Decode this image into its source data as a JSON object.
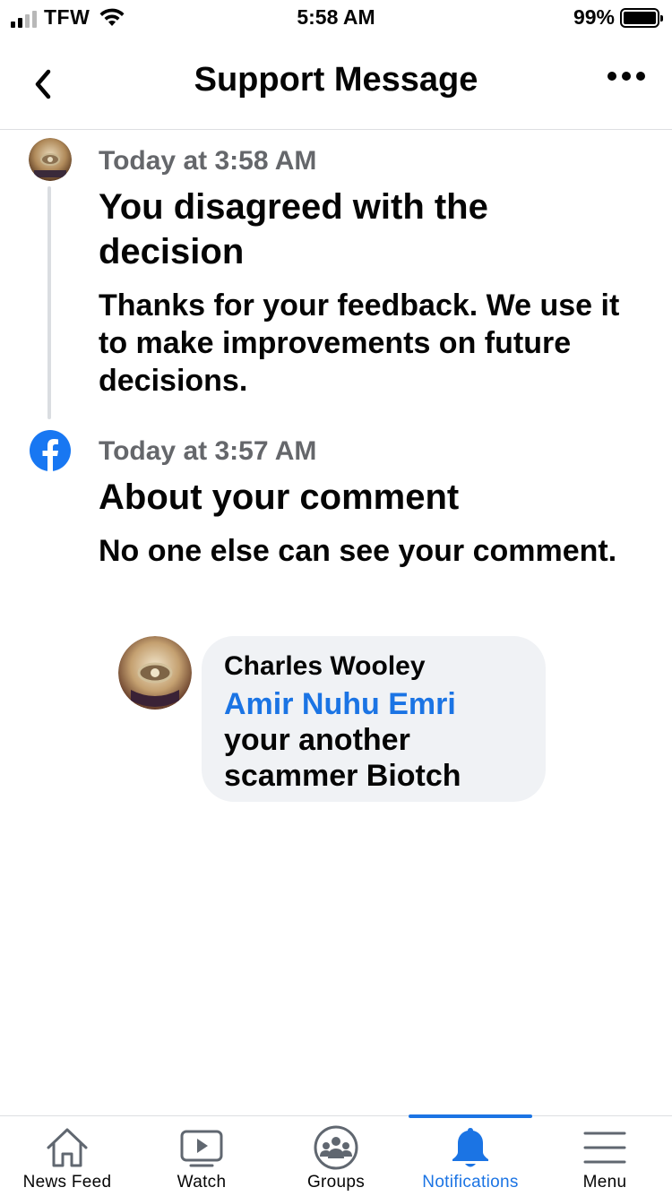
{
  "status_bar": {
    "carrier": "TFW",
    "time": "5:58 AM",
    "battery_percent": "99%",
    "battery_level": 0.99,
    "signal_bars": 2,
    "icons": [
      "signal-icon",
      "wifi-icon",
      "battery-icon"
    ]
  },
  "header": {
    "title": "Support Message",
    "back_icon": "chevron-left-icon",
    "more_icon": "more-horizontal-icon"
  },
  "timeline": [
    {
      "time": "Today at 3:58 AM",
      "title": "You disagreed with the decision",
      "body": "Thanks for your feedback. We use it to make improvements on future decisions.",
      "icon": "avatar"
    },
    {
      "time": "Today at 3:57 AM",
      "title": "About your comment",
      "body": "No one else can see your comment.",
      "icon": "facebook-logo-icon"
    }
  ],
  "comment": {
    "author": "Charles Wooley",
    "mention": "Amir Nuhu Emri",
    "text": " your another scammer Biotch"
  },
  "tabs": [
    {
      "label": "News Feed",
      "icon": "home-icon",
      "active": false
    },
    {
      "label": "Watch",
      "icon": "video-play-icon",
      "active": false
    },
    {
      "label": "Groups",
      "icon": "groups-icon",
      "active": false
    },
    {
      "label": "Notifications",
      "icon": "bell-icon",
      "active": true
    },
    {
      "label": "Menu",
      "icon": "hamburger-menu-icon",
      "active": false
    }
  ],
  "colors": {
    "accent": "#1b74e4",
    "secondary_text": "#65676b",
    "bubble_bg": "#f0f2f5",
    "divider": "#dddfe2"
  }
}
